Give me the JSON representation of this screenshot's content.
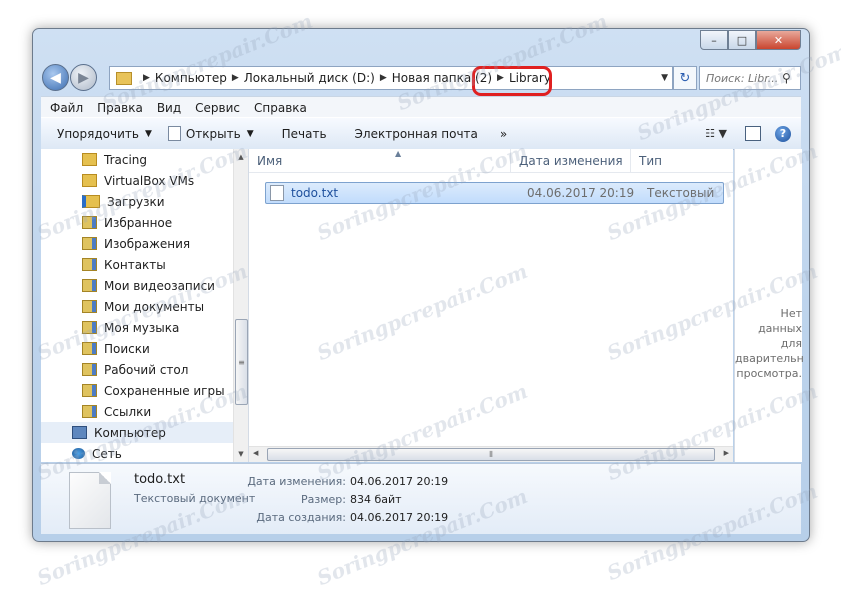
{
  "window": {
    "title_buttons": {
      "minimize": "–",
      "maximize": "□",
      "close": "✕"
    }
  },
  "nav": {
    "back_icon": "arrow-left",
    "forward_icon": "arrow-right"
  },
  "address": {
    "crumbs": [
      "Компьютер",
      "Локальный диск (D:)",
      "Новая папка (2)",
      "Library"
    ]
  },
  "search": {
    "placeholder": "Поиск: Libr..."
  },
  "menu": [
    "Файл",
    "Правка",
    "Вид",
    "Сервис",
    "Справка"
  ],
  "toolbar": {
    "organize": "Упорядочить",
    "open": "Открыть",
    "print": "Печать",
    "email": "Электронная почта",
    "more": "»"
  },
  "tree": [
    {
      "label": "Tracing",
      "icon": "folder"
    },
    {
      "label": "VirtualBox VMs",
      "icon": "folder"
    },
    {
      "label": "Загрузки",
      "icon": "downloads-folder"
    },
    {
      "label": "Избранное",
      "icon": "favorites-folder"
    },
    {
      "label": "Изображения",
      "icon": "pictures-folder"
    },
    {
      "label": "Контакты",
      "icon": "contacts-folder"
    },
    {
      "label": "Мои видеозаписи",
      "icon": "videos-folder"
    },
    {
      "label": "Мои документы",
      "icon": "documents-folder"
    },
    {
      "label": "Моя музыка",
      "icon": "music-folder"
    },
    {
      "label": "Поиски",
      "icon": "searches-folder"
    },
    {
      "label": "Рабочий стол",
      "icon": "desktop-folder"
    },
    {
      "label": "Сохраненные игры",
      "icon": "games-folder"
    },
    {
      "label": "Ссылки",
      "icon": "links-folder"
    },
    {
      "label": "Компьютер",
      "icon": "computer"
    },
    {
      "label": "Сеть",
      "icon": "network"
    }
  ],
  "columns": {
    "name": "Имя",
    "date": "Дата изменения",
    "type": "Тип"
  },
  "files": [
    {
      "name": "todo.txt",
      "date": "04.06.2017 20:19",
      "type": "Текстовый до"
    }
  ],
  "preview": {
    "lines": [
      "Нет данных",
      "для",
      "дварительн",
      "просмотра."
    ]
  },
  "details": {
    "name": "todo.txt",
    "type": "Текстовый документ",
    "modified_label": "Дата изменения:",
    "modified_value": "04.06.2017 20:19",
    "size_label": "Размер:",
    "size_value": "834 байт",
    "created_label": "Дата создания:",
    "created_value": "04.06.2017 20:19"
  },
  "watermark": "Soringpcrepair.Com",
  "colors": {
    "highlight": "#e02020",
    "selection": "#c1dcfc",
    "link": "#1e4f9c"
  }
}
